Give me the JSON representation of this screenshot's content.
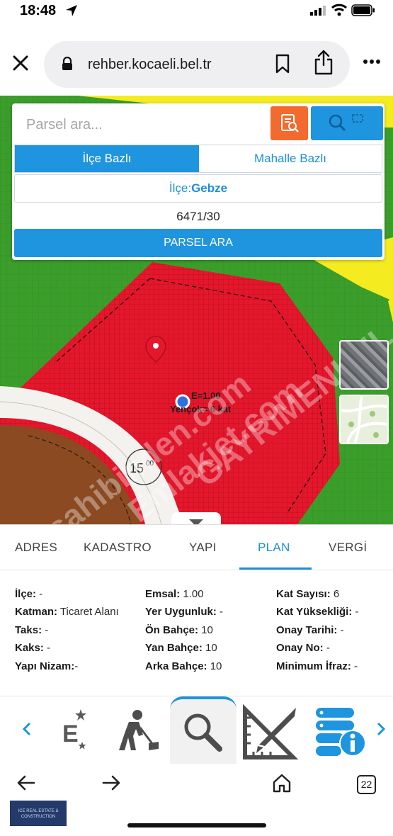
{
  "status_bar": {
    "time": "18:48"
  },
  "browser": {
    "url": "rehber.kocaeli.bel.tr"
  },
  "search_panel": {
    "placeholder": "Parsel ara...",
    "tab_district": "İlçe Bazlı",
    "tab_neighborhood": "Mahalle Bazlı",
    "district_label": "İlçe:",
    "district_value": "Gebze",
    "parcel_value": "6471/30",
    "search_button": "PARSEL ARA"
  },
  "map": {
    "zoning_text_line1": "E=1.00",
    "zoning_text_line2": "Yençok= 6 kat",
    "road_label": "15",
    "road_label_sup": "00",
    "watermarks": [
      "sahibinden.com",
      "Emlakjet.com",
      "GAYRIMENKUL"
    ],
    "colors": {
      "green": "#3b9e2b",
      "red": "#e4172c",
      "yellow": "#f4ec20",
      "brown": "#8b4a22",
      "road": "#f4f2ee"
    }
  },
  "info_tabs": [
    "ADRES",
    "KADASTRO",
    "YAPI",
    "PLAN",
    "VERGİ"
  ],
  "active_tab": "PLAN",
  "plan_fields": {
    "col1": [
      {
        "label": "İlçe:",
        "value": " -"
      },
      {
        "label": "Katman:",
        "value": " Ticaret Alanı"
      },
      {
        "label": "Taks:",
        "value": " -"
      },
      {
        "label": "Kaks:",
        "value": " -"
      },
      {
        "label": "Yapı Nizam:",
        "value": "-"
      }
    ],
    "col2": [
      {
        "label": "Emsal:",
        "value": " 1.00"
      },
      {
        "label": "Yer Uygunluk:",
        "value": " -"
      },
      {
        "label": "Ön Bahçe:",
        "value": " 10"
      },
      {
        "label": "Yan Bahçe:",
        "value": " 10"
      },
      {
        "label": "Arka Bahçe:",
        "value": " 10"
      }
    ],
    "col3": [
      {
        "label": "Kat Sayısı:",
        "value": " 6"
      },
      {
        "label": "Kat Yüksekliği:",
        "value": " -"
      },
      {
        "label": "Onay Tarihi:",
        "value": " -"
      },
      {
        "label": "Onay No:",
        "value": " -"
      },
      {
        "label": "Minimum İfraz:",
        "value": " -"
      }
    ]
  },
  "dock": {
    "icons": [
      "e-municipality-icon",
      "construction-worker-icon",
      "magnifier-icon",
      "ruler-pencil-icon",
      "server-info-icon"
    ],
    "brand_letter": "E"
  },
  "nav": {
    "tab_count": "22"
  },
  "logo_text": "ICE REAL ESTATE & CONSTRUCTION"
}
